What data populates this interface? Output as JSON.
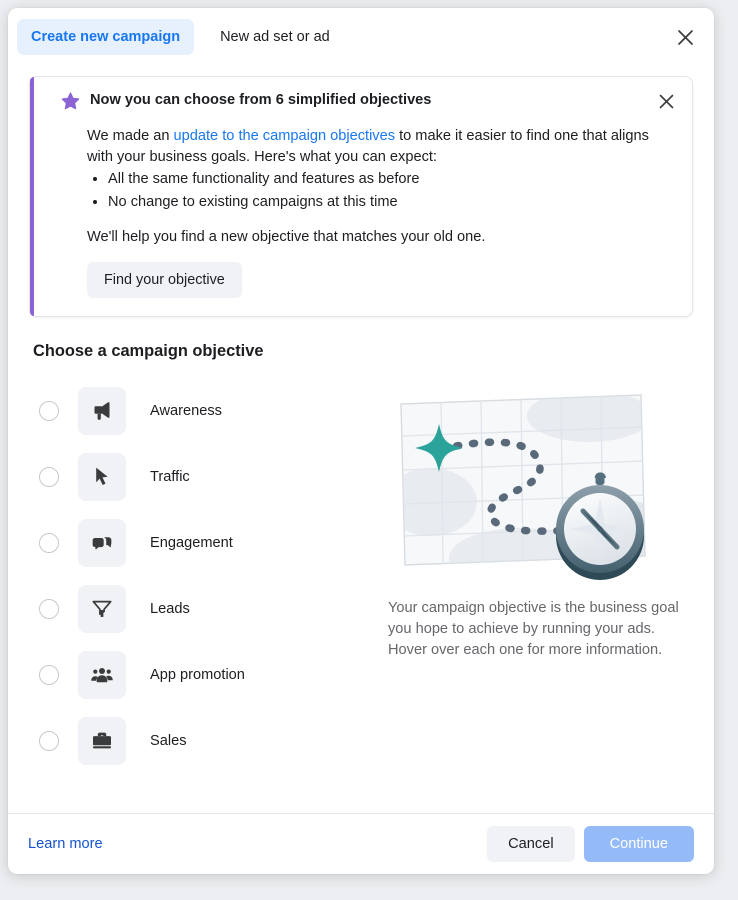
{
  "header": {
    "tabs": [
      {
        "label": "Create new campaign",
        "active": true
      },
      {
        "label": "New ad set or ad",
        "active": false
      }
    ],
    "close_icon": "close-icon"
  },
  "notice": {
    "icon": "star-icon",
    "title": "Now you can choose from 6 simplified objectives",
    "close_icon": "close-icon",
    "paragraph_prefix": "We made an ",
    "link_text": "update to the campaign objectives",
    "paragraph_suffix": " to make it easier to find one that aligns with your business goals. Here's what you can expect:",
    "bullets": [
      "All the same functionality and features as before",
      "No change to existing campaigns at this time"
    ],
    "closing_text": "We'll help you find a new objective that matches your old one.",
    "button_label": "Find your objective",
    "accent_color": "#8b63d4"
  },
  "main": {
    "section_title": "Choose a campaign objective",
    "objectives": [
      {
        "label": "Awareness",
        "icon": "megaphone-icon",
        "selected": false
      },
      {
        "label": "Traffic",
        "icon": "cursor-icon",
        "selected": false
      },
      {
        "label": "Engagement",
        "icon": "chat-bubbles-icon",
        "selected": false
      },
      {
        "label": "Leads",
        "icon": "funnel-icon",
        "selected": false
      },
      {
        "label": "App promotion",
        "icon": "people-icon",
        "selected": false
      },
      {
        "label": "Sales",
        "icon": "briefcase-icon",
        "selected": false
      }
    ],
    "illustration": {
      "name": "map-with-compass-illustration",
      "star_color": "#2ba39a",
      "compass_color": "#46606e"
    },
    "description": "Your campaign objective is the business goal you hope to achieve by running your ads. Hover over each one for more information."
  },
  "footer": {
    "learn_more_label": "Learn more",
    "cancel_label": "Cancel",
    "continue_label": "Continue",
    "continue_disabled": true
  },
  "colors": {
    "accent_blue": "#1877f2",
    "link_blue": "#1652ce",
    "purple": "#8b63d4",
    "teal": "#2ba39a",
    "surface": "#ffffff",
    "muted_text": "#65676b"
  }
}
